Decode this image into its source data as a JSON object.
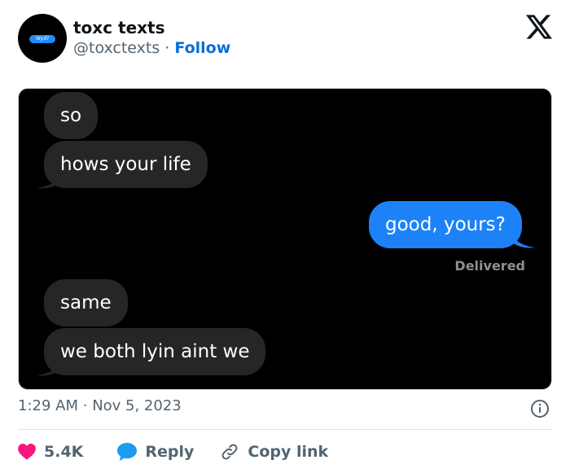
{
  "author": {
    "display_name": "toxc texts",
    "handle": "@toxctexts",
    "follow_label": "Follow",
    "avatar_text": "Wyd?"
  },
  "conversation": {
    "messages": [
      {
        "side": "incoming",
        "text": "so"
      },
      {
        "side": "incoming",
        "text": "hows your life"
      },
      {
        "side": "outgoing",
        "text": "good, yours?"
      },
      {
        "side": "incoming",
        "text": "same"
      },
      {
        "side": "incoming",
        "text": "we both lyin aint we"
      }
    ],
    "delivery_status": "Delivered"
  },
  "meta": {
    "time": "1:29 AM",
    "date": "Nov 5, 2023"
  },
  "actions": {
    "like_count": "5.4K",
    "reply_label": "Reply",
    "copy_link_label": "Copy link"
  },
  "colors": {
    "outgoing_bubble": "#1d82f7",
    "incoming_bubble": "#262628",
    "follow_link": "#0b6fd6",
    "like_heart": "#f91880",
    "reply_icon": "#1d9bf0"
  },
  "icons": [
    "x-logo-icon",
    "info-icon",
    "heart-icon",
    "reply-icon",
    "link-icon"
  ]
}
